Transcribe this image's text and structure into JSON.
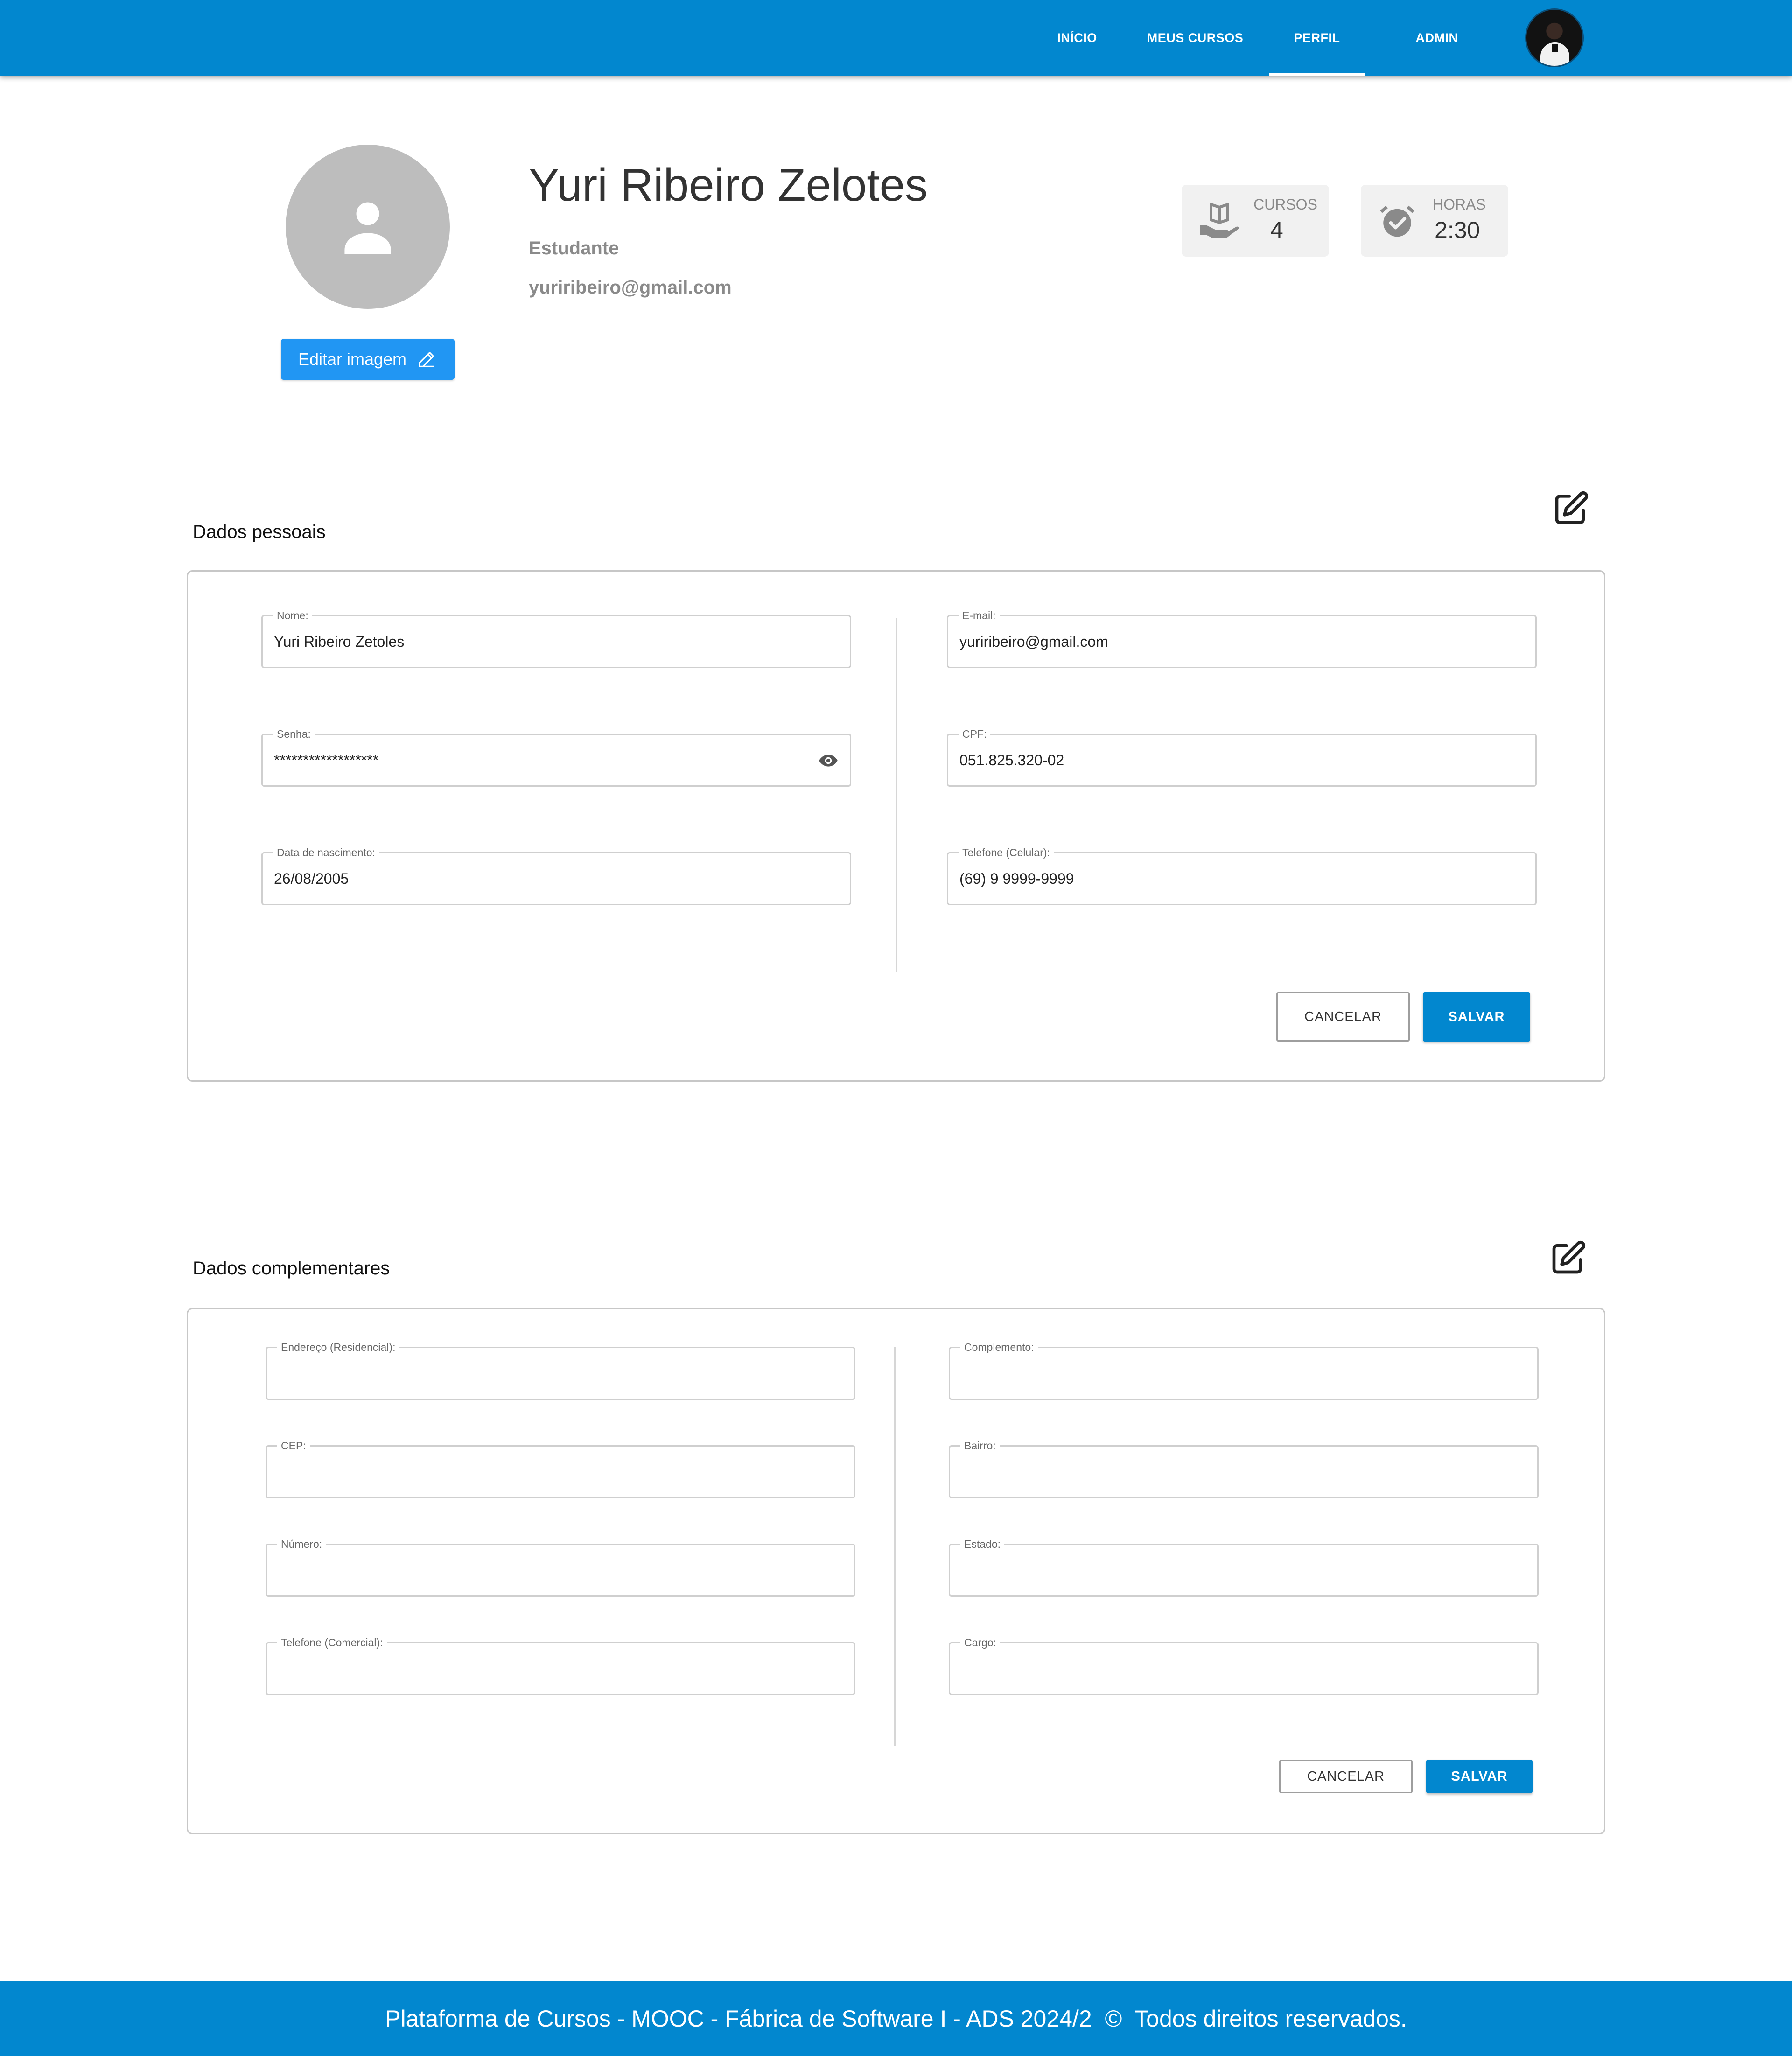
{
  "nav": {
    "links": [
      "INÍCIO",
      "MEUS CURSOS",
      "PERFIL",
      "ADMIN"
    ],
    "active": "PERFIL",
    "accent": "#0287cf"
  },
  "profile": {
    "name": "Yuri Ribeiro Zelotes",
    "role": "Estudante",
    "email": "yuriribeiro@gmail.com",
    "edit_image_label": "Editar imagem",
    "avatar_icon": "person-icon"
  },
  "stats": [
    {
      "label": "CURSOS",
      "value": "4",
      "icon": "book-hand-icon"
    },
    {
      "label": "HORAS",
      "value": "2:30",
      "icon": "alarm-check-icon"
    }
  ],
  "personal": {
    "title": "Dados pessoais",
    "fields": [
      {
        "label": "Nome:",
        "value": "Yuri Ribeiro Zetoles"
      },
      {
        "label": "E-mail:",
        "value": "yuriribeiro@gmail.com"
      },
      {
        "label": "Senha:",
        "value": "******************"
      },
      {
        "label": "CPF:",
        "value": "051.825.320-02"
      },
      {
        "label": "Data de nascimento:",
        "value": "26/08/2005"
      },
      {
        "label": "Telefone (Celular):",
        "value": "(69) 9 9999-9999"
      }
    ],
    "cancel_label": "CANCELAR",
    "save_label": "SALVAR"
  },
  "complementary": {
    "title": "Dados complementares",
    "fields": [
      {
        "label": "Endereço (Residencial):",
        "value": ""
      },
      {
        "label": "Complemento:",
        "value": ""
      },
      {
        "label": "CEP:",
        "value": ""
      },
      {
        "label": "Bairro:",
        "value": ""
      },
      {
        "label": "Número:",
        "value": ""
      },
      {
        "label": "Estado:",
        "value": ""
      },
      {
        "label": "Telefone (Comercial):",
        "value": ""
      },
      {
        "label": "Cargo:",
        "value": ""
      }
    ],
    "cancel_label": "CANCELAR",
    "save_label": "SALVAR"
  },
  "footer": {
    "text": "Plataforma de Cursos - MOOC - Fábrica de Software I - ADS 2024/2  ©  Todos direitos reservados."
  }
}
